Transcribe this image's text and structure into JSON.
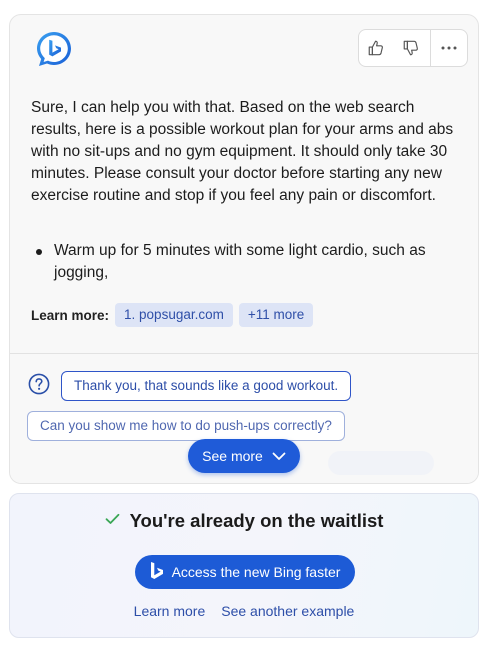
{
  "chat": {
    "avatar_icon": "bing-chat-icon",
    "feedback": {
      "like_icon": "thumbs-up-icon",
      "dislike_icon": "thumbs-down-icon",
      "more_icon": "more-options-icon"
    },
    "answer": "Sure, I can help you with that. Based on the web search results, here is a possible workout plan for your arms and abs with no sit-ups and no gym equipment. It should only take 30 minutes. Please consult your doctor before starting any new exercise routine and stop if you feel any pain or discomfort.",
    "bullets": [
      "Warm up for 5 minutes with some light cardio, such as jogging,"
    ],
    "learn_more": {
      "label": "Learn more:",
      "sources": [
        "1. popsugar.com",
        "+11 more"
      ]
    },
    "suggestions": [
      "Thank you, that sounds like a good workout.",
      "Can you show me how to do push-ups correctly?"
    ],
    "see_more_label": "See more"
  },
  "waitlist": {
    "title": "You're already on the waitlist",
    "access_button": "Access the new Bing faster",
    "links": [
      "Learn more",
      "See another example"
    ],
    "colors": {
      "accent": "#1d5bd6",
      "check": "#3aa655"
    }
  }
}
